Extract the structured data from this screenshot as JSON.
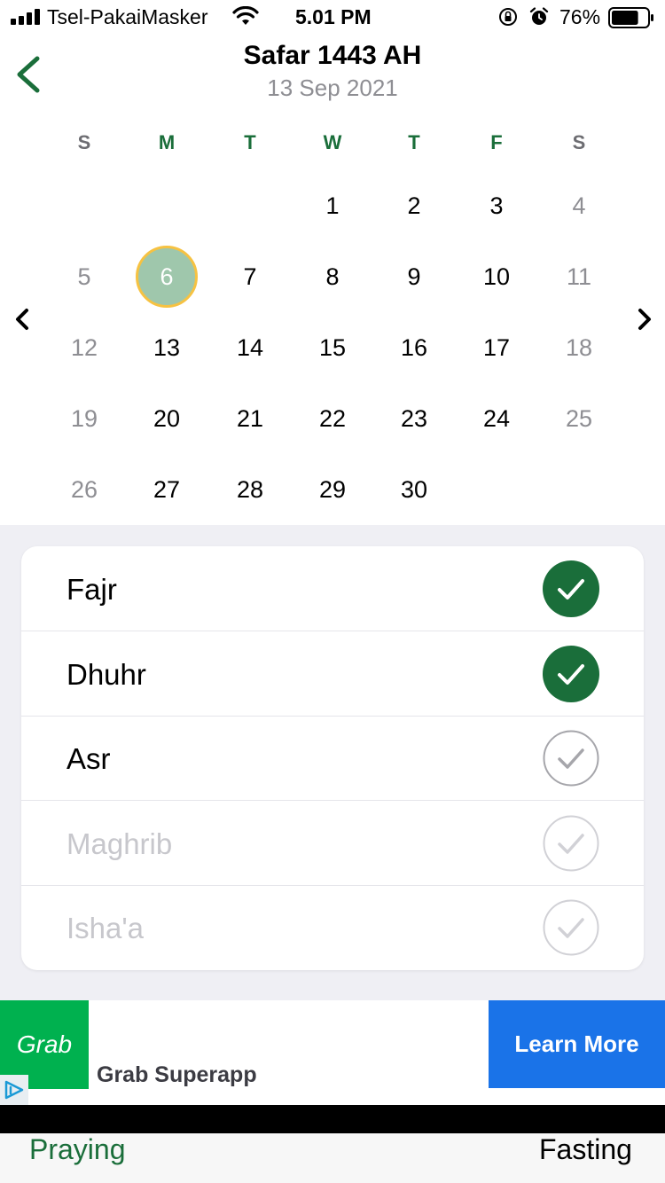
{
  "status_bar": {
    "carrier": "Tsel-PakaiMasker",
    "time": "5.01 PM",
    "battery_percent": "76%",
    "battery_level": 0.76
  },
  "header": {
    "title": "Safar 1443 AH",
    "subtitle": "13 Sep 2021"
  },
  "calendar": {
    "weekdays": [
      "S",
      "M",
      "T",
      "W",
      "T",
      "F",
      "S"
    ],
    "weeks": [
      [
        "",
        "",
        "",
        "1",
        "2",
        "3",
        "4"
      ],
      [
        "5",
        "6",
        "7",
        "8",
        "9",
        "10",
        "11"
      ],
      [
        "12",
        "13",
        "14",
        "15",
        "16",
        "17",
        "18"
      ],
      [
        "19",
        "20",
        "21",
        "22",
        "23",
        "24",
        "25"
      ],
      [
        "26",
        "27",
        "28",
        "29",
        "30",
        "",
        ""
      ]
    ],
    "selected_day": "6",
    "colors": {
      "accent": "#1a6e3a",
      "selected_fill": "#9fc7ac",
      "selected_ring": "#f6c242"
    }
  },
  "prayers": [
    {
      "name": "Fajr",
      "checked": true,
      "muted": false
    },
    {
      "name": "Dhuhr",
      "checked": true,
      "muted": false
    },
    {
      "name": "Asr",
      "checked": false,
      "muted": false
    },
    {
      "name": "Maghrib",
      "checked": false,
      "muted": true
    },
    {
      "name": "Isha'a",
      "checked": false,
      "muted": true
    }
  ],
  "ad": {
    "logo_text": "Grab",
    "title": "Grab Superapp",
    "button_label": "Learn More"
  },
  "tabs": {
    "praying": "Praying",
    "fasting": "Fasting"
  }
}
